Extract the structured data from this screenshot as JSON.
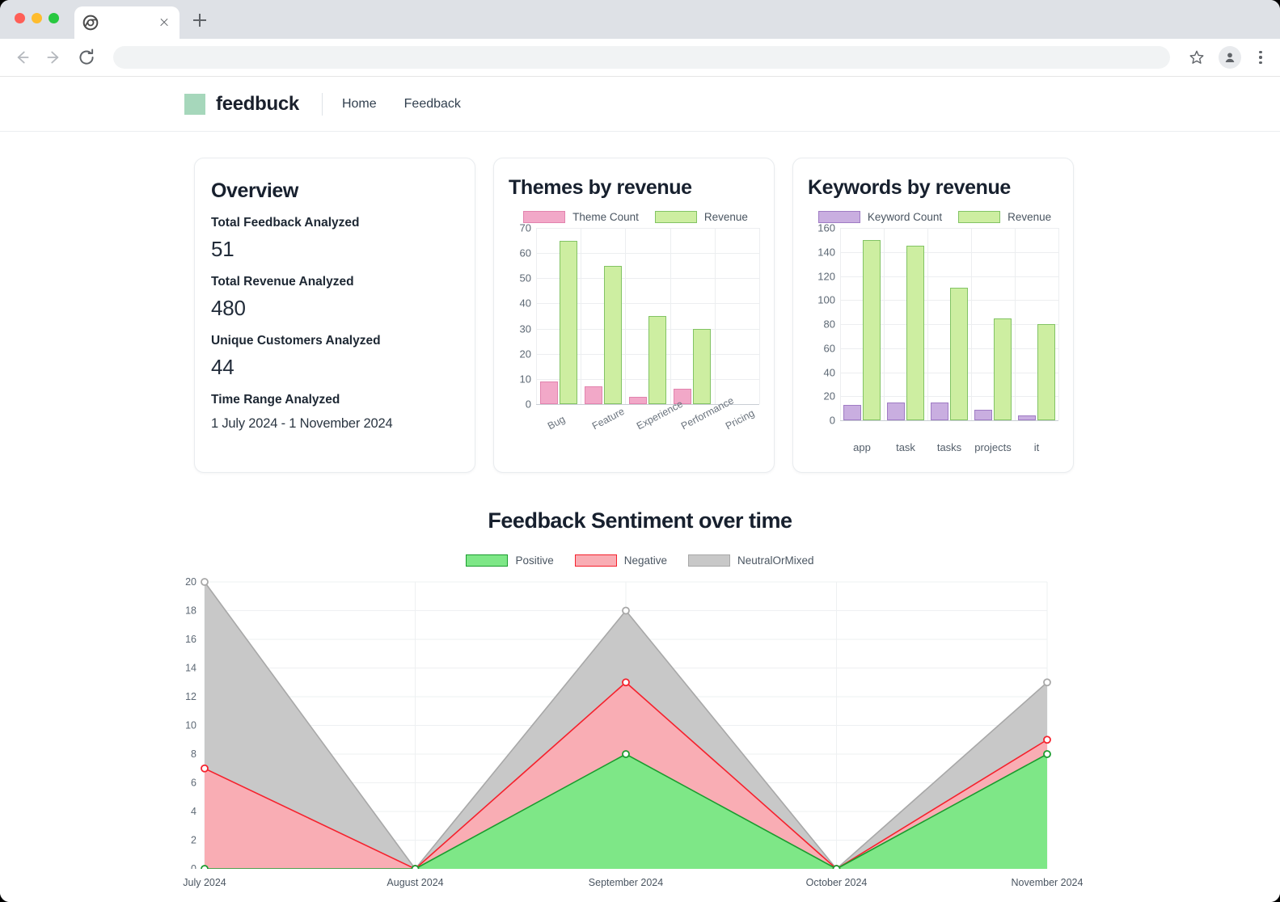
{
  "browser": {
    "tab": {
      "title": "",
      "favicon_icon": "chrome-logo-icon",
      "close_icon": "close-icon"
    },
    "new_tab_icon": "plus-icon",
    "back_icon": "back-arrow-icon",
    "forward_icon": "forward-arrow-icon",
    "reload_icon": "reload-icon",
    "omnibox_value": "",
    "omnibox_placeholder": "",
    "bookmark_icon": "star-icon",
    "profile_icon": "person-avatar-icon",
    "menu_icon": "three-dot-menu-icon"
  },
  "appbar": {
    "brand_name": "feedbuck",
    "brand_mark_color": "#a6d7bb",
    "links": [
      {
        "label": "Home"
      },
      {
        "label": "Feedback"
      }
    ]
  },
  "overview": {
    "title": "Overview",
    "metrics": [
      {
        "label": "Total Feedback Analyzed",
        "value": "51"
      },
      {
        "label": "Total Revenue Analyzed",
        "value": "480"
      },
      {
        "label": "Unique Customers Analyzed",
        "value": "44"
      },
      {
        "label": "Time Range Analyzed",
        "value": "1 July 2024 - 1 November 2024"
      }
    ]
  },
  "chart_data": [
    {
      "type": "bar",
      "title": "Themes by revenue",
      "categories": [
        "Bug",
        "Feature",
        "Experience",
        "Performance",
        "Pricing"
      ],
      "series": [
        {
          "name": "Theme Count",
          "values": [
            9,
            7,
            3,
            6,
            0
          ],
          "color": "#f2a8c8",
          "border": "#e283ae"
        },
        {
          "name": "Revenue",
          "values": [
            65,
            55,
            35,
            30,
            0
          ],
          "color": "#cdeea1",
          "border": "#82c364"
        }
      ],
      "xlabel": "",
      "ylabel": "",
      "ylim": [
        0,
        70
      ],
      "yticks": [
        0,
        10,
        20,
        30,
        40,
        50,
        60,
        70
      ],
      "grid": true,
      "legend_position": "top"
    },
    {
      "type": "bar",
      "title": "Keywords by revenue",
      "categories": [
        "app",
        "task",
        "tasks",
        "projects",
        "it"
      ],
      "series": [
        {
          "name": "Keyword Count",
          "values": [
            13,
            15,
            15,
            9,
            4
          ],
          "color": "#c9aee0",
          "border": "#9f7bc4"
        },
        {
          "name": "Revenue",
          "values": [
            150,
            145,
            110,
            85,
            80
          ],
          "color": "#cdeea1",
          "border": "#82c364"
        }
      ],
      "xlabel": "",
      "ylabel": "",
      "ylim": [
        0,
        160
      ],
      "yticks": [
        0,
        20,
        40,
        60,
        80,
        100,
        120,
        140,
        160
      ],
      "grid": true,
      "legend_position": "top"
    },
    {
      "type": "area",
      "title": "Feedback Sentiment over time",
      "categories": [
        "July 2024",
        "August 2024",
        "September 2024",
        "October 2024",
        "November 2024"
      ],
      "series": [
        {
          "name": "Positive",
          "values": [
            0,
            0,
            8,
            0,
            8
          ],
          "color": "#7ee787",
          "border": "#1a9c2e"
        },
        {
          "name": "Negative",
          "values": [
            7,
            0,
            13,
            0,
            9
          ],
          "color": "#f9adb4",
          "border": "#f5222d"
        },
        {
          "name": "NeutralOrMixed",
          "values": [
            20,
            0,
            18,
            0,
            13
          ],
          "color": "#c8c8c8",
          "border": "#a8a8a8"
        }
      ],
      "xlabel": "",
      "ylabel": "",
      "ylim": [
        0,
        20
      ],
      "yticks": [
        0,
        2,
        4,
        6,
        8,
        10,
        12,
        14,
        16,
        18,
        20
      ],
      "grid": true,
      "legend_position": "top"
    }
  ]
}
